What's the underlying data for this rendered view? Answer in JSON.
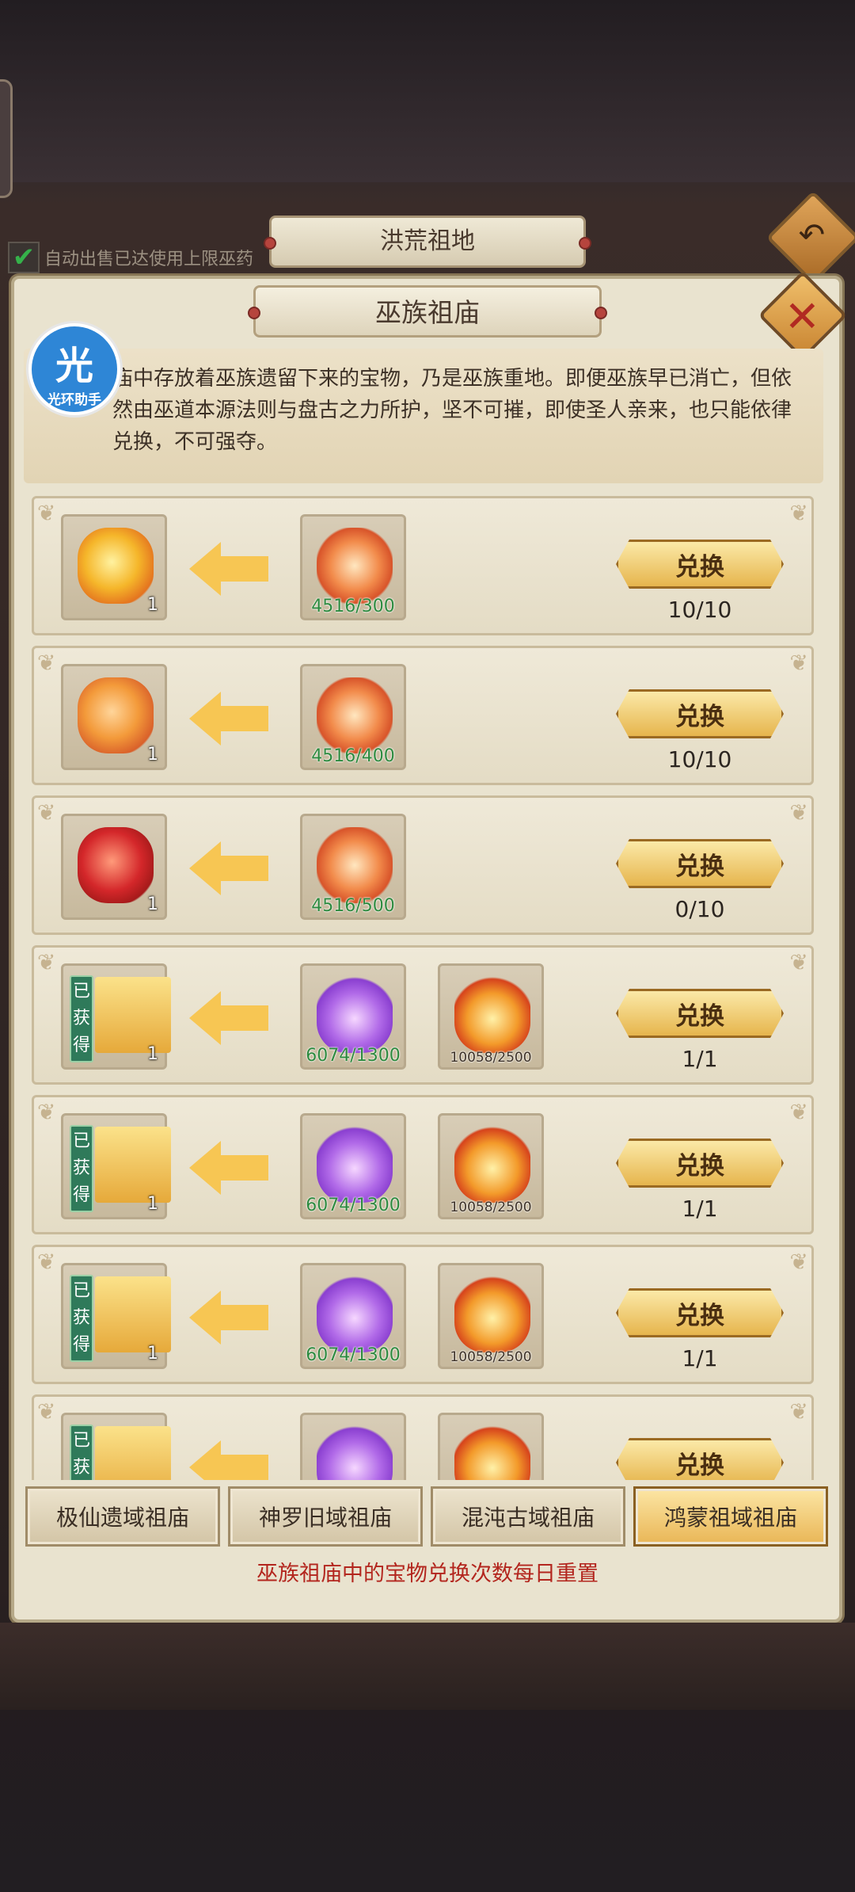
{
  "header": {
    "title": "洪荒祖地",
    "back_icon": "back-arrow-icon"
  },
  "auto_sell": {
    "label": "自动出售已达使用上限巫药",
    "checked": true
  },
  "panel": {
    "title": "巫族祖庙",
    "close_icon": "close-icon"
  },
  "overlay_badge": {
    "glyph": "光",
    "label": "光环助手"
  },
  "description": "巫族祖庙中存放着巫族遗留下来的宝物，乃是巫族重地。即便巫族早已消亡，但依然由巫道本源法则与盘古之力所护，坚不可摧，即使圣人亲来，也只能依律兑换，不可强夺。",
  "description_visible": "庙中存放着巫族遗留下来的宝物，乃是巫族重地。即便巫族早已消亡，但依然由巫道本源法则与盘古之力所护，坚不可摧，即使圣人亲来，也只能依律兑换，不可强夺。",
  "exchange_rows": [
    {
      "reward_count": "1",
      "costs": [
        "4516/300"
      ],
      "button": "兑换",
      "quota": "10/10",
      "obtained": ""
    },
    {
      "reward_count": "1",
      "costs": [
        "4516/400"
      ],
      "button": "兑换",
      "quota": "10/10",
      "obtained": ""
    },
    {
      "reward_count": "1",
      "costs": [
        "4516/500"
      ],
      "button": "兑换",
      "quota": "0/10",
      "obtained": ""
    },
    {
      "reward_count": "1",
      "costs": [
        "6074/1300",
        "10058/2500"
      ],
      "button": "兑换",
      "quota": "1/1",
      "obtained": "已获得"
    },
    {
      "reward_count": "1",
      "costs": [
        "6074/1300",
        "10058/2500"
      ],
      "button": "兑换",
      "quota": "1/1",
      "obtained": "已获得"
    },
    {
      "reward_count": "1",
      "costs": [
        "6074/1300",
        "10058/2500"
      ],
      "button": "兑换",
      "quota": "1/1",
      "obtained": "已获得"
    },
    {
      "reward_count": "",
      "costs": [
        "",
        ""
      ],
      "button": "兑换",
      "quota": "",
      "obtained": "已获得"
    }
  ],
  "tabs": [
    {
      "label": "极仙遗域祖庙",
      "active": false
    },
    {
      "label": "神罗旧域祖庙",
      "active": false
    },
    {
      "label": "混沌古域祖庙",
      "active": false
    },
    {
      "label": "鸿蒙祖域祖庙",
      "active": true
    }
  ],
  "reset_note": "巫族祖庙中的宝物兑换次数每日重置",
  "colors": {
    "accent_gold": "#e6b54d",
    "note_red": "#b3261e",
    "need_green": "#2c8a3e"
  }
}
